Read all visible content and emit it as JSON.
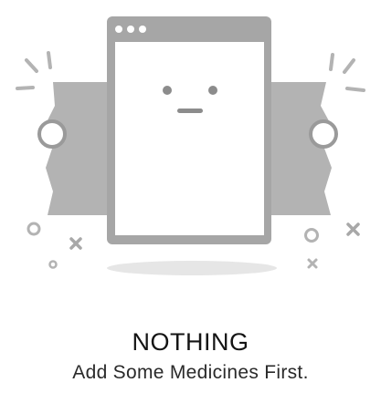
{
  "empty_state": {
    "illustration_icon": "empty-browser-window-face",
    "title": "NOTHING",
    "subtitle": "Add Some Medicines First."
  },
  "colors": {
    "background": "#ffffff",
    "illustration_gray": "#b0b0b0",
    "illustration_dark": "#8c8c8c",
    "window_fill": "#ffffff",
    "title_text": "#141414",
    "subtitle_text": "#2a2a2a"
  }
}
